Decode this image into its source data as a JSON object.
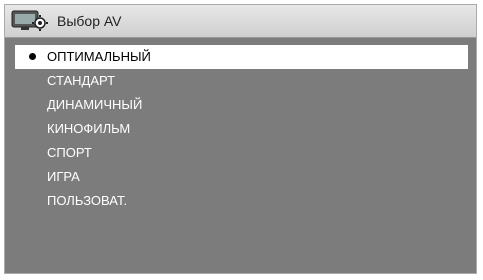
{
  "header": {
    "title": "Выбор AV",
    "icon": "tv-settings-icon"
  },
  "menu": {
    "items": [
      {
        "label": "ОПТИМАЛЬНЫЙ",
        "selected": true
      },
      {
        "label": "СТАНДАРТ",
        "selected": false
      },
      {
        "label": "ДИНАМИЧНЫЙ",
        "selected": false
      },
      {
        "label": "КИНОФИЛЬМ",
        "selected": false
      },
      {
        "label": "СПОРТ",
        "selected": false
      },
      {
        "label": "ИГРА",
        "selected": false
      },
      {
        "label": "ПОЛЬЗОВАТ.",
        "selected": false
      }
    ]
  },
  "colors": {
    "panel_bg": "#7c7c7c",
    "selected_bg": "#ffffff",
    "text": "#ffffff",
    "selected_text": "#000000"
  }
}
